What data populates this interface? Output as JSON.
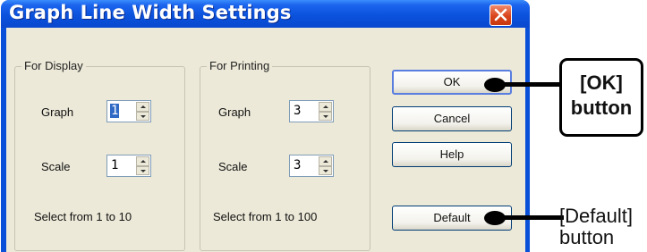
{
  "window": {
    "title": "Graph Line Width Settings",
    "close_icon": "close-x-icon"
  },
  "display_group": {
    "label": "For Display",
    "graph_label": "Graph",
    "graph_value": "1",
    "scale_label": "Scale",
    "scale_value": "1",
    "hint": "Select from 1 to 10"
  },
  "printing_group": {
    "label": "For Printing",
    "graph_label": "Graph",
    "graph_value": "3",
    "scale_label": "Scale",
    "scale_value": "3",
    "hint": "Select from 1 to 100"
  },
  "buttons": {
    "ok": "OK",
    "cancel": "Cancel",
    "help": "Help",
    "default": "Default"
  },
  "annotations": {
    "ok_callout_line1": "[OK]",
    "ok_callout_line2": "button",
    "default_callout_line1": "[Default]",
    "default_callout_line2": "button"
  },
  "colors": {
    "titlebar": "#0a4fd8",
    "client": "#ece9d8",
    "close_button": "#d9441c"
  }
}
